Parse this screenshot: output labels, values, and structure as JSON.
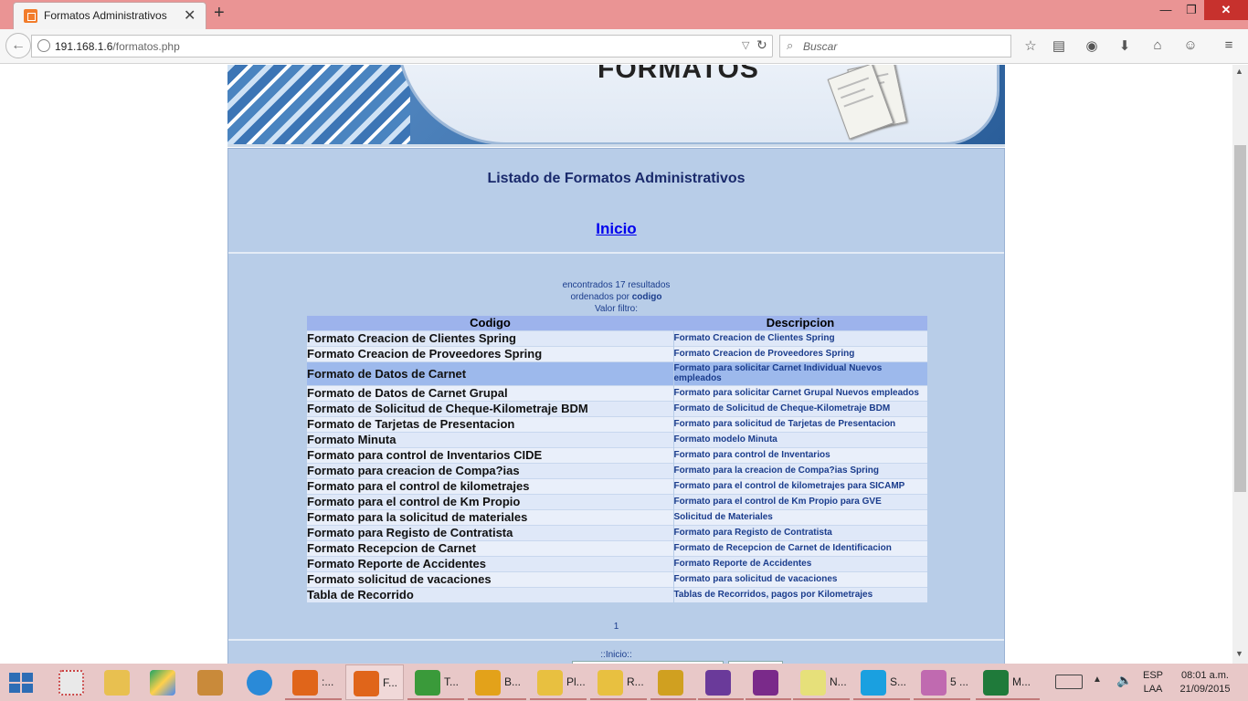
{
  "browser": {
    "tab_title": "Formatos Administrativos",
    "url_host": "191.168.1.6",
    "url_path": "/formatos.php",
    "search_placeholder": "Buscar"
  },
  "banner": {
    "title": "FORMATOS"
  },
  "page": {
    "title": "Listado de Formatos Administrativos",
    "home_link": "Inicio",
    "found_text": "encontrados 17 resultados",
    "ordered_prefix": "ordenados por",
    "ordered_field": "codigo",
    "filter_text": "Valor filtro:",
    "pager_page": "1",
    "footer_link": "::Inicio::"
  },
  "table": {
    "headers": [
      "Codigo",
      "Descripcion"
    ],
    "rows": [
      {
        "code": "Formato Creacion de Clientes Spring",
        "desc": "Formato Creacion de Clientes Spring"
      },
      {
        "code": "Formato Creacion de Proveedores Spring",
        "desc": "Formato Creacion de Proveedores Spring"
      },
      {
        "code": "Formato de Datos de Carnet",
        "desc": "Formato para solicitar Carnet Individual Nuevos empleados"
      },
      {
        "code": "Formato de Datos de Carnet Grupal",
        "desc": "Formato para solicitar Carnet Grupal Nuevos empleados"
      },
      {
        "code": "Formato de Solicitud de Cheque-Kilometraje BDM",
        "desc": "Formato de Solicitud de Cheque-Kilometraje BDM"
      },
      {
        "code": "Formato de Tarjetas de Presentacion",
        "desc": "Formato para solicitud de Tarjetas de Presentacion"
      },
      {
        "code": "Formato Minuta",
        "desc": "Formato modelo Minuta"
      },
      {
        "code": "Formato para control de Inventarios CIDE",
        "desc": "Formato para control de Inventarios"
      },
      {
        "code": "Formato para creacion de Compa?ias",
        "desc": "Formato para la creacion de Compa?ias Spring"
      },
      {
        "code": "Formato para el control de kilometrajes",
        "desc": "Formato para el control de kilometrajes para SICAMP"
      },
      {
        "code": "Formato para el control de Km Propio",
        "desc": "Formato para el control de Km Propio para GVE"
      },
      {
        "code": "Formato para la solicitud de materiales",
        "desc": "Solicitud de Materiales"
      },
      {
        "code": "Formato para Registo de Contratista",
        "desc": "Formato para Registo de Contratista"
      },
      {
        "code": "Formato Recepcion de Carnet",
        "desc": "Formato de Recepcion de Carnet de Identificacion"
      },
      {
        "code": "Formato Reporte de Accidentes",
        "desc": "Formato Reporte de Accidentes"
      },
      {
        "code": "Formato solicitud de vacaciones",
        "desc": "Formato para solicitud de vacaciones"
      },
      {
        "code": "Tabla de Recorrido",
        "desc": "Tablas de Recorridos, pagos por Kilometrajes"
      }
    ]
  },
  "taskbar": {
    "items": [
      {
        "label": ":...",
        "color": "#e0651a",
        "icon": "firefox-icon"
      },
      {
        "label": "F...",
        "color": "#e0651a",
        "icon": "firefox-icon"
      },
      {
        "label": "T...",
        "color": "#3a9a3a",
        "icon": "chrome-icon"
      },
      {
        "label": "B...",
        "color": "#e3a21a",
        "icon": "outlook-icon"
      },
      {
        "label": "Pl...",
        "color": "#e8c040",
        "icon": "mail-icon"
      },
      {
        "label": "R...",
        "color": "#e8c040",
        "icon": "mail-icon"
      },
      {
        "label": "",
        "color": "#d0a020",
        "icon": "tools-icon"
      },
      {
        "label": "",
        "color": "#6a3a9a",
        "icon": "visual-studio-icon"
      },
      {
        "label": "",
        "color": "#7a2a8a",
        "icon": "onenote-icon"
      },
      {
        "label": "N...",
        "color": "#e6e07a",
        "icon": "sticky-notes-icon"
      },
      {
        "label": "S...",
        "color": "#1aa0e0",
        "icon": "skype-icon"
      },
      {
        "label": "5 ...",
        "color": "#c06ab0",
        "icon": "paint-icon"
      },
      {
        "label": "M...",
        "color": "#1f7a3a",
        "icon": "excel-icon"
      }
    ],
    "lang_top": "ESP",
    "lang_bottom": "LAA",
    "time": "08:01 a.m.",
    "date": "21/09/2015"
  }
}
